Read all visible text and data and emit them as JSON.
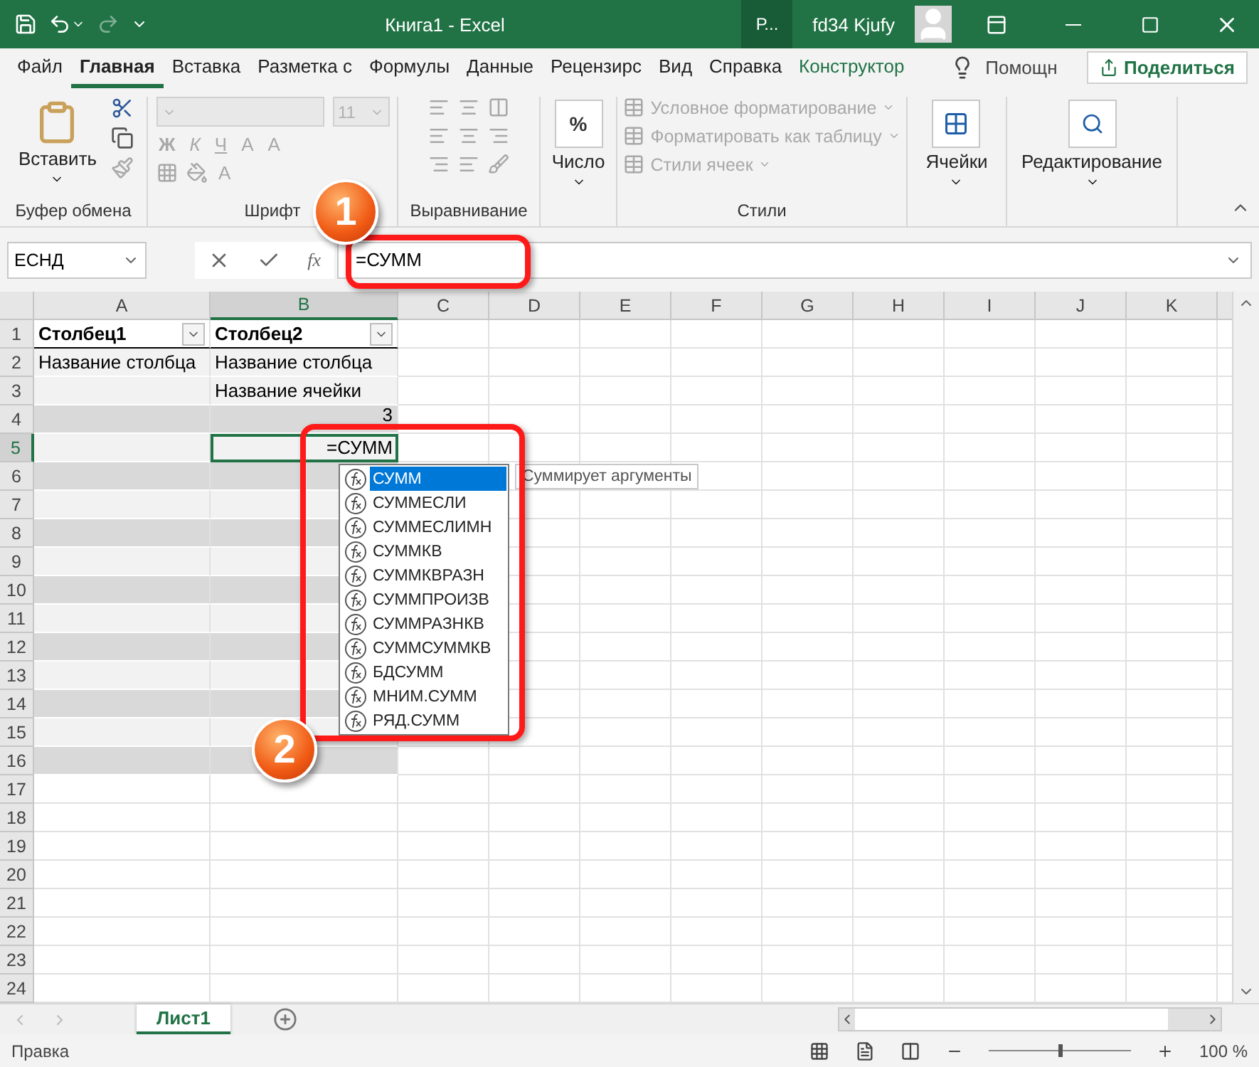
{
  "title_bar": {
    "title": "Книга1  -  Excel",
    "ribbon_mode": "Р...",
    "user": "fd34 Kjufy"
  },
  "tabs": [
    {
      "label": "Файл",
      "selected": false,
      "kind": "normal"
    },
    {
      "label": "Главная",
      "selected": true,
      "kind": "normal"
    },
    {
      "label": "Вставка",
      "selected": false,
      "kind": "normal"
    },
    {
      "label": "Разметка с",
      "selected": false,
      "kind": "normal"
    },
    {
      "label": "Формулы",
      "selected": false,
      "kind": "normal"
    },
    {
      "label": "Данные",
      "selected": false,
      "kind": "normal"
    },
    {
      "label": "Рецензирс",
      "selected": false,
      "kind": "normal"
    },
    {
      "label": "Вид",
      "selected": false,
      "kind": "normal"
    },
    {
      "label": "Справка",
      "selected": false,
      "kind": "normal"
    },
    {
      "label": "Конструктор",
      "selected": false,
      "kind": "contextual"
    }
  ],
  "tell_me": "Помощн",
  "share": "Поделиться",
  "ribbon_groups": [
    {
      "kind": "clipboard",
      "label": "Буфер обмена",
      "button": "Вставить"
    },
    {
      "kind": "font",
      "label": "Шрифт",
      "font_size": "11",
      "bold": "Ж",
      "italic": "К",
      "underline": "Ч",
      "grow": "A",
      "shrink": "A",
      "font_color": "A",
      "disabled": true
    },
    {
      "kind": "alignment",
      "label": "Выравнивание",
      "disabled": true
    },
    {
      "kind": "number",
      "button": "Число",
      "symbol": "%"
    },
    {
      "kind": "styles",
      "label": "Стили",
      "items": [
        "Условное форматирование",
        "Форматировать как таблицу",
        "Стили ячеек"
      ],
      "disabled": true
    },
    {
      "kind": "cells",
      "button": "Ячейки"
    },
    {
      "kind": "editing",
      "button": "Редактирование"
    }
  ],
  "formula_bar": {
    "name_box": "ЕСНД",
    "fx": "fx",
    "formula": "=СУММ"
  },
  "columns": [
    {
      "label": "A",
      "selected": false
    },
    {
      "label": "B",
      "selected": true
    },
    {
      "label": "C",
      "selected": false
    },
    {
      "label": "D",
      "selected": false
    },
    {
      "label": "E",
      "selected": false
    },
    {
      "label": "F",
      "selected": false
    },
    {
      "label": "G",
      "selected": false
    },
    {
      "label": "H",
      "selected": false
    },
    {
      "label": "I",
      "selected": false
    },
    {
      "label": "J",
      "selected": false
    },
    {
      "label": "K",
      "selected": false
    }
  ],
  "rows": [
    {
      "number": "1",
      "selected": false,
      "kind": "table_header",
      "cells": [
        {
          "text": "Столбец1",
          "kind": "text",
          "selected": false
        },
        {
          "text": "Столбец2",
          "kind": "text",
          "selected": false
        }
      ]
    },
    {
      "number": "2",
      "selected": false,
      "kind": "table_row",
      "cells": [
        {
          "text": "Название столбца",
          "kind": "text",
          "selected": false
        },
        {
          "text": "Название столбца",
          "kind": "text",
          "selected": false
        }
      ]
    },
    {
      "number": "3",
      "selected": false,
      "kind": "table_row",
      "cells": [
        {
          "selected": false
        },
        {
          "text": "Название ячейки",
          "kind": "text",
          "selected": false
        }
      ]
    },
    {
      "number": "4",
      "selected": false,
      "kind": "table_row",
      "cells": [
        {
          "selected": false
        },
        {
          "text": "3",
          "kind": "number",
          "selected": false
        }
      ]
    },
    {
      "number": "5",
      "selected": true,
      "kind": "table_row",
      "cells": [
        {
          "selected": false
        },
        {
          "text": "=СУММ",
          "kind": "formula",
          "selected": true
        }
      ]
    },
    {
      "number": "6",
      "selected": false,
      "kind": "table_row",
      "cells": [
        {
          "selected": false
        },
        {
          "selected": false
        }
      ]
    },
    {
      "number": "7",
      "selected": false,
      "kind": "table_row",
      "cells": [
        {
          "selected": false
        },
        {
          "selected": false
        }
      ]
    },
    {
      "number": "8",
      "selected": false,
      "kind": "table_row",
      "cells": [
        {
          "selected": false
        },
        {
          "selected": false
        }
      ]
    },
    {
      "number": "9",
      "selected": false,
      "kind": "table_row",
      "cells": [
        {
          "selected": false
        },
        {
          "selected": false
        }
      ]
    },
    {
      "number": "10",
      "selected": false,
      "kind": "table_row",
      "cells": [
        {
          "selected": false
        },
        {
          "selected": false
        }
      ]
    },
    {
      "number": "11",
      "selected": false,
      "kind": "table_row",
      "cells": [
        {
          "selected": false
        },
        {
          "selected": false
        }
      ]
    },
    {
      "number": "12",
      "selected": false,
      "kind": "table_row",
      "cells": [
        {
          "selected": false
        },
        {
          "selected": false
        }
      ]
    },
    {
      "number": "13",
      "selected": false,
      "kind": "table_row",
      "cells": [
        {
          "selected": false
        },
        {
          "selected": false
        }
      ]
    },
    {
      "number": "14",
      "selected": false,
      "kind": "table_row",
      "cells": [
        {
          "selected": false
        },
        {
          "selected": false
        }
      ]
    },
    {
      "number": "15",
      "selected": false,
      "kind": "table_row",
      "cells": [
        {
          "selected": false
        },
        {
          "selected": false
        }
      ]
    },
    {
      "number": "16",
      "selected": false,
      "kind": "table_row",
      "cells": [
        {
          "selected": false
        },
        {
          "selected": false
        }
      ]
    },
    {
      "number": "17",
      "selected": false,
      "kind": "plain"
    },
    {
      "number": "18",
      "selected": false,
      "kind": "plain"
    },
    {
      "number": "19",
      "selected": false,
      "kind": "plain"
    },
    {
      "number": "20",
      "selected": false,
      "kind": "plain"
    },
    {
      "number": "21",
      "selected": false,
      "kind": "plain"
    },
    {
      "number": "22",
      "selected": false,
      "kind": "plain"
    },
    {
      "number": "23",
      "selected": false,
      "kind": "plain"
    },
    {
      "number": "24",
      "selected": false,
      "kind": "plain"
    }
  ],
  "autocomplete": {
    "items": [
      {
        "label": "СУММ",
        "selected": true
      },
      {
        "label": "СУММЕСЛИ",
        "selected": false
      },
      {
        "label": "СУММЕСЛИМН",
        "selected": false
      },
      {
        "label": "СУММКВ",
        "selected": false
      },
      {
        "label": "СУММКВРАЗН",
        "selected": false
      },
      {
        "label": "СУММПРОИЗВ",
        "selected": false
      },
      {
        "label": "СУММРАЗНКВ",
        "selected": false
      },
      {
        "label": "СУММСУММКВ",
        "selected": false
      },
      {
        "label": "БДСУММ",
        "selected": false
      },
      {
        "label": "МНИМ.СУММ",
        "selected": false
      },
      {
        "label": "РЯД.СУММ",
        "selected": false
      }
    ],
    "tooltip": "Суммирует аргументы"
  },
  "annotations": [
    {
      "label": "1"
    },
    {
      "label": "2"
    }
  ],
  "sheet_tabs": [
    {
      "label": "Лист1",
      "selected": true
    }
  ],
  "status_bar": {
    "mode": "Правка",
    "zoom_slider": {
      "level": 0.5
    },
    "zoom": "100 %"
  }
}
